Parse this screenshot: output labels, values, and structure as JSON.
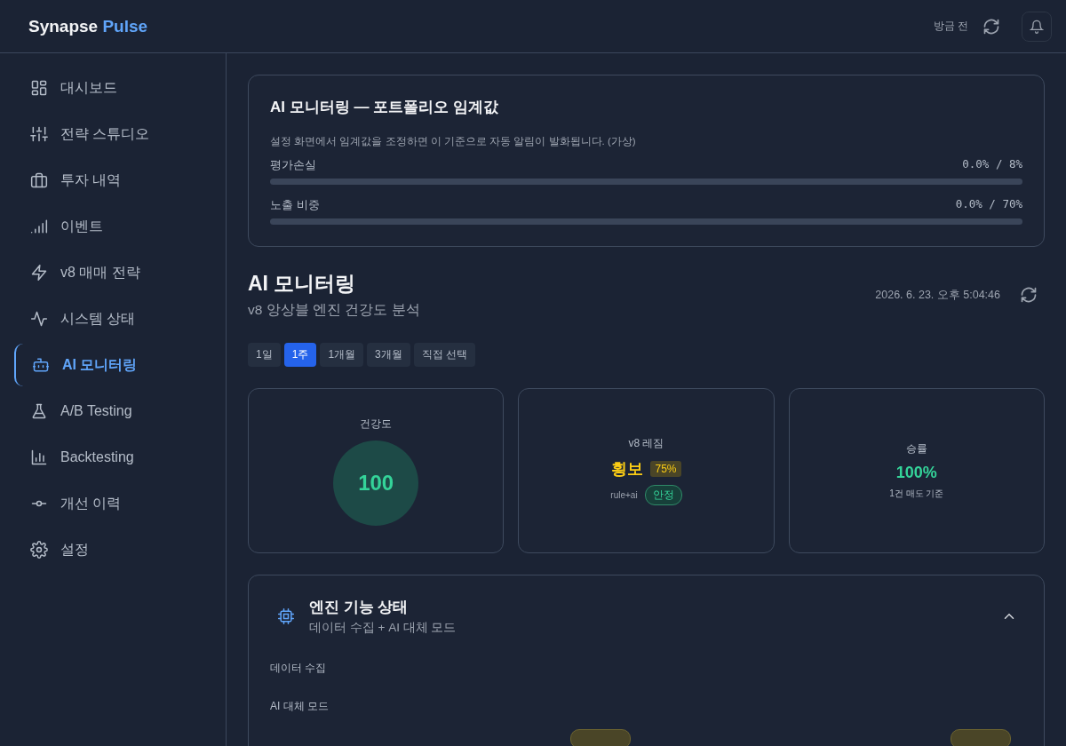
{
  "header": {
    "brand": "Synapse",
    "brand_accent": "Pulse",
    "updated": "방금 전"
  },
  "sidebar": {
    "items": [
      {
        "label": "대시보드",
        "selected": false
      },
      {
        "label": "전략 스튜디오",
        "selected": false
      },
      {
        "label": "투자 내역",
        "selected": false
      },
      {
        "label": "이벤트",
        "selected": false
      },
      {
        "label": "v8 매매 전략",
        "selected": false
      },
      {
        "label": "시스템 상태",
        "selected": false
      },
      {
        "label": "AI 모니터링",
        "selected": true
      },
      {
        "label": "A/B Testing",
        "selected": false
      },
      {
        "label": "Backtesting",
        "selected": false
      },
      {
        "label": "개선 이력",
        "selected": false
      },
      {
        "label": "설정",
        "selected": false
      }
    ]
  },
  "threshold_card": {
    "title": "AI 모니터링 — 포트폴리오 임계값",
    "note": "설정 화면에서 임계값을 조정하면 이 기준으로 자동 알림이 발화됩니다. (가상)",
    "meters": [
      {
        "label": "평가손실",
        "reading": "0.0% / 8%",
        "level": 0
      },
      {
        "label": "노출 비중",
        "reading": "0.0% / 70%",
        "level": 0
      }
    ]
  },
  "page": {
    "title": "AI 모니터링",
    "subtitle": "v8 앙상블 엔진 건강도 분석",
    "timestamp": "2026. 6. 23. 오후 5:04:46"
  },
  "range_tabs": [
    {
      "label": "1일",
      "selected": false
    },
    {
      "label": "1주",
      "selected": true
    },
    {
      "label": "1개월",
      "selected": false
    },
    {
      "label": "3개월",
      "selected": false
    },
    {
      "label": "직접 선택",
      "selected": false
    }
  ],
  "stat_cards": [
    {
      "kind": "gauge",
      "label": "건강도",
      "value": "100"
    },
    {
      "kind": "regime",
      "label": "v8 레짐",
      "value": "횡보",
      "confidence": "75%",
      "mode": "rule+ai",
      "status": "안정"
    },
    {
      "kind": "rate",
      "label": "승률",
      "value": "100%",
      "note": "1건 매도 기준"
    }
  ],
  "engine_panel": {
    "title": "엔진 기능 상태",
    "subtitle": "데이터 수집 + AI 대체 모드",
    "expanded": true,
    "rows": [
      "데이터 수집",
      "AI 대체 모드"
    ]
  }
}
